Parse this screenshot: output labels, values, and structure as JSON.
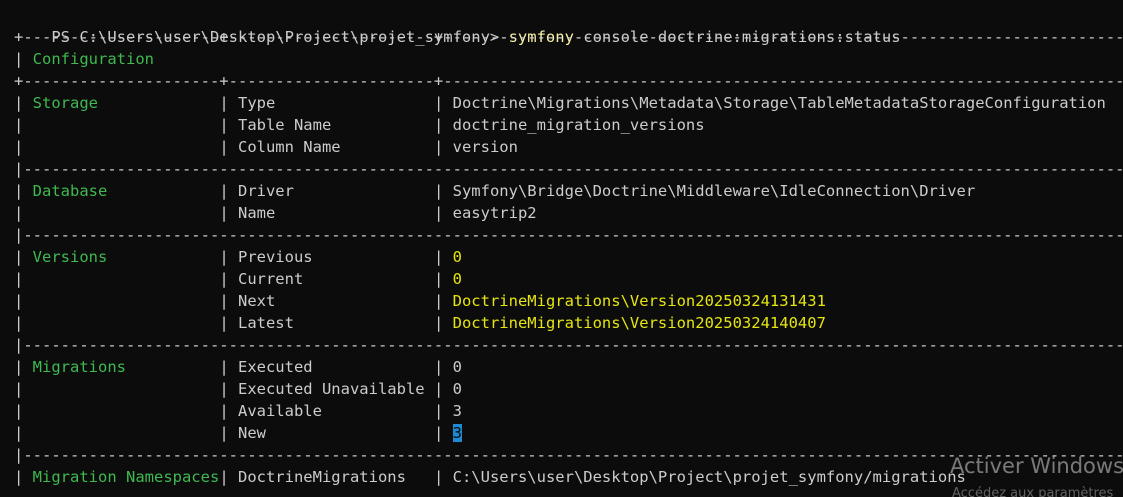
{
  "prompt": {
    "path": "PS C:\\Users\\user\\Desktop\\Project\\projet_symfony> ",
    "command": "symfony",
    "args": " console doctrine:migrations:status"
  },
  "colors": {
    "section": "#3fb950",
    "highlight": "#e5e510",
    "text": "#cccccc",
    "background": "#0c0c0c",
    "cursor": "#1f8ad2"
  },
  "table": {
    "configuration_title": "Configuration",
    "sections": [
      {
        "name": "Storage",
        "rows": [
          {
            "key": "Type",
            "value": "Doctrine\\Migrations\\Metadata\\Storage\\TableMetadataStorageConfiguration",
            "highlight": false
          },
          {
            "key": "Table Name",
            "value": "doctrine_migration_versions",
            "highlight": false
          },
          {
            "key": "Column Name",
            "value": "version",
            "highlight": false
          }
        ]
      },
      {
        "name": "Database",
        "rows": [
          {
            "key": "Driver",
            "value": "Symfony\\Bridge\\Doctrine\\Middleware\\IdleConnection\\Driver",
            "highlight": false
          },
          {
            "key": "Name",
            "value": "easytrip2",
            "highlight": false
          }
        ]
      },
      {
        "name": "Versions",
        "rows": [
          {
            "key": "Previous",
            "value": "0",
            "highlight": true
          },
          {
            "key": "Current",
            "value": "0",
            "highlight": true
          },
          {
            "key": "Next",
            "value": "DoctrineMigrations\\Version20250324131431",
            "highlight": true
          },
          {
            "key": "Latest",
            "value": "DoctrineMigrations\\Version20250324140407",
            "highlight": true
          }
        ]
      },
      {
        "name": "Migrations",
        "rows": [
          {
            "key": "Executed",
            "value": "0",
            "highlight": false
          },
          {
            "key": "Executed Unavailable",
            "value": "0",
            "highlight": false
          },
          {
            "key": "Available",
            "value": "3",
            "highlight": false
          },
          {
            "key": "New",
            "value": "3",
            "highlight": false,
            "selected": true
          }
        ]
      },
      {
        "name": "Migration Namespaces",
        "rows": [
          {
            "key": "DoctrineMigrations",
            "value": "C:\\Users\\user\\Desktop\\Project\\projet_symfony/migrations",
            "highlight": false
          }
        ]
      }
    ]
  },
  "watermark": {
    "title": "Activer Windows",
    "subtitle": "Accédez aux paramètres"
  }
}
